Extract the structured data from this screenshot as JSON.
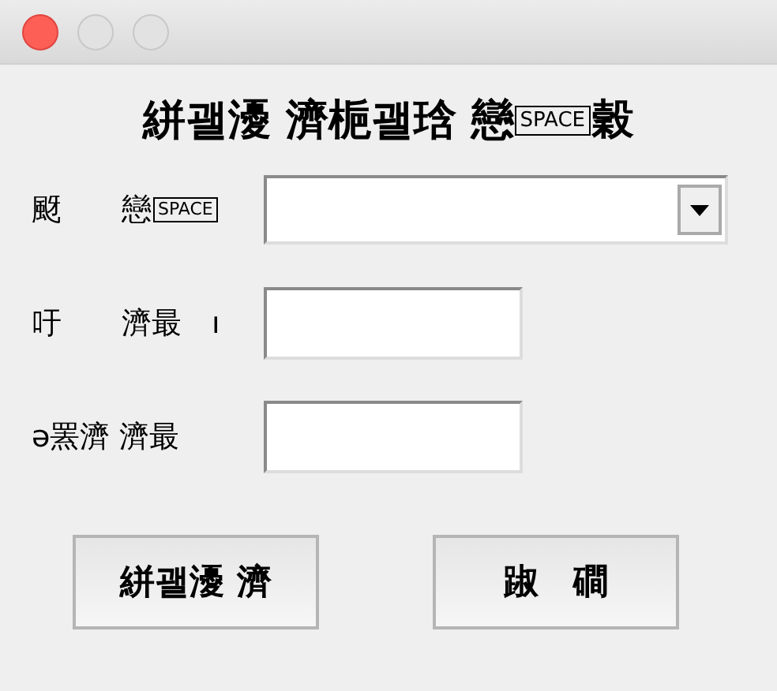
{
  "window": {
    "controls": [
      {
        "kind": "close"
      },
      {
        "kind": "minimize"
      },
      {
        "kind": "zoom"
      }
    ]
  },
  "heading": {
    "parts": [
      {
        "kind": "text",
        "text": "絣괠瀀 濟梔괠琀 戀"
      },
      {
        "kind": "key",
        "text": "SPACE"
      },
      {
        "kind": "text",
        "text": "穀"
      }
    ]
  },
  "fields": [
    {
      "kind": "combo",
      "label": [
        {
          "kind": "text",
          "text": "颬　　戀"
        },
        {
          "kind": "key",
          "text": "SPACE"
        }
      ]
    },
    {
      "kind": "text",
      "label": [
        {
          "kind": "text",
          "text": "吁　　濟最　ı"
        }
      ]
    },
    {
      "kind": "text",
      "label": [
        {
          "kind": "text",
          "text": "ə罴濟 濟最"
        }
      ]
    }
  ],
  "buttons": [
    "絣괠瀀 濟",
    "踧　磵"
  ]
}
